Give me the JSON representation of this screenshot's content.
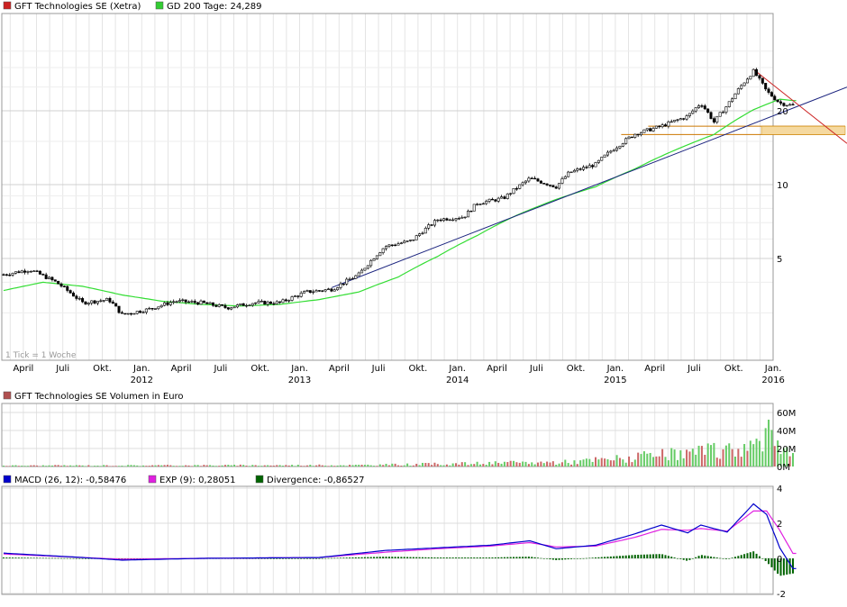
{
  "chart_data": [
    {
      "type": "candlestick",
      "legend": [
        {
          "label": "GFT Technologies SE (Xetra)",
          "color": "#cc2222"
        },
        {
          "label": "GD 200 Tage: 24,289",
          "color": "#33cc33"
        }
      ],
      "note": "1 Tick = 1 Woche",
      "y_scale": "log",
      "ylim": [
        2.5,
        40
      ],
      "y_ticks": [
        "5",
        "10",
        "20"
      ],
      "x_month_labels": [
        "April",
        "Juli",
        "Okt.",
        "Jan.",
        "April",
        "Juli",
        "Okt.",
        "Jan.",
        "April",
        "Juli",
        "Okt.",
        "Jan.",
        "April",
        "Juli",
        "Okt.",
        "Jan.",
        "April",
        "Juli",
        "Okt.",
        "Jan."
      ],
      "x_year_labels": [
        "2012",
        "2013",
        "2014",
        "2015",
        "2016"
      ],
      "price_anchors": [
        {
          "date": "2011-03",
          "price": 4.3
        },
        {
          "date": "2011-05",
          "price": 4.5
        },
        {
          "date": "2011-07",
          "price": 4.0
        },
        {
          "date": "2011-09",
          "price": 3.3
        },
        {
          "date": "2011-11",
          "price": 3.4
        },
        {
          "date": "2011-12",
          "price": 2.95
        },
        {
          "date": "2012-02",
          "price": 3.1
        },
        {
          "date": "2012-04",
          "price": 3.35
        },
        {
          "date": "2012-06",
          "price": 3.3
        },
        {
          "date": "2012-08",
          "price": 3.15
        },
        {
          "date": "2012-10",
          "price": 3.3
        },
        {
          "date": "2012-12",
          "price": 3.3
        },
        {
          "date": "2013-02",
          "price": 3.65
        },
        {
          "date": "2013-04",
          "price": 3.75
        },
        {
          "date": "2013-06",
          "price": 4.3
        },
        {
          "date": "2013-08",
          "price": 5.6
        },
        {
          "date": "2013-10",
          "price": 5.9
        },
        {
          "date": "2013-12",
          "price": 7.2
        },
        {
          "date": "2014-02",
          "price": 7.4
        },
        {
          "date": "2014-03",
          "price": 8.4
        },
        {
          "date": "2014-05",
          "price": 8.8
        },
        {
          "date": "2014-07",
          "price": 10.6
        },
        {
          "date": "2014-09",
          "price": 9.8
        },
        {
          "date": "2014-10",
          "price": 11.2
        },
        {
          "date": "2014-12",
          "price": 12.1
        },
        {
          "date": "2015-01",
          "price": 13.5
        },
        {
          "date": "2015-03",
          "price": 16.1
        },
        {
          "date": "2015-05",
          "price": 17.3
        },
        {
          "date": "2015-07",
          "price": 19.0
        },
        {
          "date": "2015-08",
          "price": 21.5
        },
        {
          "date": "2015-09",
          "price": 18.0
        },
        {
          "date": "2015-10",
          "price": 21.0
        },
        {
          "date": "2015-11",
          "price": 25.0
        },
        {
          "date": "2015-12",
          "price": 29.0
        },
        {
          "date": "2016-01",
          "price": 24.0
        },
        {
          "date": "2016-02",
          "price": 21.5
        },
        {
          "date": "2016-03",
          "price": 21.0
        }
      ],
      "sma200_anchors": [
        {
          "date": "2011-03",
          "price": 3.7
        },
        {
          "date": "2011-06",
          "price": 4.0
        },
        {
          "date": "2011-09",
          "price": 3.85
        },
        {
          "date": "2011-12",
          "price": 3.55
        },
        {
          "date": "2012-03",
          "price": 3.35
        },
        {
          "date": "2012-06",
          "price": 3.25
        },
        {
          "date": "2012-09",
          "price": 3.2
        },
        {
          "date": "2012-12",
          "price": 3.25
        },
        {
          "date": "2013-03",
          "price": 3.4
        },
        {
          "date": "2013-06",
          "price": 3.65
        },
        {
          "date": "2013-09",
          "price": 4.2
        },
        {
          "date": "2013-12",
          "price": 5.1
        },
        {
          "date": "2014-03",
          "price": 6.2
        },
        {
          "date": "2014-06",
          "price": 7.5
        },
        {
          "date": "2014-09",
          "price": 8.7
        },
        {
          "date": "2014-12",
          "price": 9.8
        },
        {
          "date": "2015-03",
          "price": 11.6
        },
        {
          "date": "2015-06",
          "price": 13.8
        },
        {
          "date": "2015-09",
          "price": 16.0
        },
        {
          "date": "2015-12",
          "price": 20.2
        },
        {
          "date": "2016-02",
          "price": 22.3
        },
        {
          "date": "2016-03",
          "price": 22.0
        }
      ],
      "trend_lines": [
        {
          "kind": "support",
          "color": "#1a237e",
          "from": {
            "date": "2013-06",
            "price": 4.2
          },
          "to": {
            "date": "2016-03",
            "price": 20.5
          }
        },
        {
          "kind": "resistance",
          "color": "#cc2222",
          "from": {
            "date": "2015-12",
            "price": 29.5
          },
          "to": {
            "date": "2016-03",
            "price": 22.0
          }
        }
      ],
      "support_zone": {
        "low": 16.0,
        "high": 17.3,
        "from_date": "2015-04",
        "color": "#f5d9a0"
      }
    },
    {
      "type": "bar",
      "legend": [
        {
          "label": "GFT Technologies SE Volumen in Euro",
          "color": "#b05050"
        }
      ],
      "y_ticks": [
        "0M",
        "20M",
        "40M",
        "60M"
      ],
      "ylim": [
        0,
        60
      ],
      "volume_anchors_musd": [
        {
          "date": "2011-03",
          "value": 1.0
        },
        {
          "date": "2013-06",
          "value": 1.5
        },
        {
          "date": "2014-01",
          "value": 3.0
        },
        {
          "date": "2014-10",
          "value": 5.0
        },
        {
          "date": "2015-05",
          "value": 12.0
        },
        {
          "date": "2015-10",
          "value": 18.0
        },
        {
          "date": "2016-01",
          "value": 28.0
        },
        {
          "date": "2016-03",
          "value": 18.0
        }
      ],
      "peak": {
        "date": "2016-01",
        "value": 52
      }
    },
    {
      "type": "line",
      "legend": [
        {
          "label": "MACD (26, 12): -0,58476",
          "color": "#0000cc"
        },
        {
          "label": "EXP (9): 0,28051",
          "color": "#e020e0"
        },
        {
          "label": "Divergence: -0,86527",
          "color": "#006400"
        }
      ],
      "y_ticks": [
        "4",
        "2",
        "0",
        "-2"
      ],
      "ylim": [
        -2,
        4
      ],
      "macd_anchors": [
        {
          "date": "2011-03",
          "value": 0.3
        },
        {
          "date": "2011-09",
          "value": 0.05
        },
        {
          "date": "2011-12",
          "value": -0.1
        },
        {
          "date": "2012-06",
          "value": 0.0
        },
        {
          "date": "2013-03",
          "value": 0.05
        },
        {
          "date": "2013-08",
          "value": 0.45
        },
        {
          "date": "2013-12",
          "value": 0.6
        },
        {
          "date": "2014-04",
          "value": 0.75
        },
        {
          "date": "2014-07",
          "value": 1.0
        },
        {
          "date": "2014-09",
          "value": 0.55
        },
        {
          "date": "2014-12",
          "value": 0.75
        },
        {
          "date": "2015-03",
          "value": 1.4
        },
        {
          "date": "2015-05",
          "value": 1.9
        },
        {
          "date": "2015-07",
          "value": 1.45
        },
        {
          "date": "2015-08",
          "value": 1.9
        },
        {
          "date": "2015-10",
          "value": 1.5
        },
        {
          "date": "2015-12",
          "value": 3.1
        },
        {
          "date": "2016-01",
          "value": 2.5
        },
        {
          "date": "2016-02",
          "value": 0.6
        },
        {
          "date": "2016-03",
          "value": -0.58
        }
      ],
      "signal_anchors": [
        {
          "date": "2011-03",
          "value": 0.25
        },
        {
          "date": "2011-12",
          "value": -0.05
        },
        {
          "date": "2012-06",
          "value": 0.0
        },
        {
          "date": "2013-03",
          "value": 0.05
        },
        {
          "date": "2013-08",
          "value": 0.35
        },
        {
          "date": "2013-12",
          "value": 0.55
        },
        {
          "date": "2014-04",
          "value": 0.7
        },
        {
          "date": "2014-07",
          "value": 0.9
        },
        {
          "date": "2014-09",
          "value": 0.65
        },
        {
          "date": "2014-12",
          "value": 0.7
        },
        {
          "date": "2015-03",
          "value": 1.2
        },
        {
          "date": "2015-05",
          "value": 1.65
        },
        {
          "date": "2015-07",
          "value": 1.6
        },
        {
          "date": "2015-08",
          "value": 1.7
        },
        {
          "date": "2015-10",
          "value": 1.55
        },
        {
          "date": "2015-12",
          "value": 2.7
        },
        {
          "date": "2016-01",
          "value": 2.7
        },
        {
          "date": "2016-02",
          "value": 1.6
        },
        {
          "date": "2016-03",
          "value": 0.28
        }
      ]
    }
  ]
}
